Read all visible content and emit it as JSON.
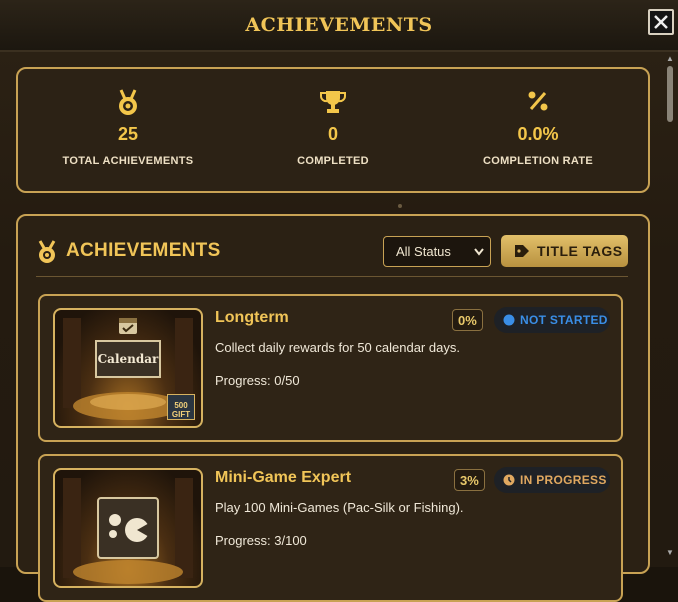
{
  "header": {
    "title": "ACHIEVEMENTS"
  },
  "stats": [
    {
      "icon": "medal-icon",
      "value": "25",
      "label": "TOTAL ACHIEVEMENTS"
    },
    {
      "icon": "trophy-icon",
      "value": "0",
      "label": "COMPLETED"
    },
    {
      "icon": "percent-icon",
      "value": "0.0%",
      "label": "COMPLETION RATE"
    }
  ],
  "achievements_panel": {
    "title": "ACHIEVEMENTS",
    "filter_selected": "All Status",
    "tags_button": "TITLE TAGS"
  },
  "cards": [
    {
      "name": "Longterm",
      "percent": "0%",
      "status": "NOT STARTED",
      "status_color": "#3a8ee6",
      "description": "Collect daily rewards for 50 calendar days.",
      "progress": "Progress: 0/50",
      "image_label": "Calendar",
      "gift_label": "500 GIFT"
    },
    {
      "name": "Mini-Game Expert",
      "percent": "3%",
      "status": "IN PROGRESS",
      "status_color": "#e0a860",
      "description": "Play 100 Mini-Games (Pac-Silk or Fishing).",
      "progress": "Progress: 3/100"
    }
  ],
  "colors": {
    "accent": "#f1c558",
    "border": "#c8a254"
  }
}
